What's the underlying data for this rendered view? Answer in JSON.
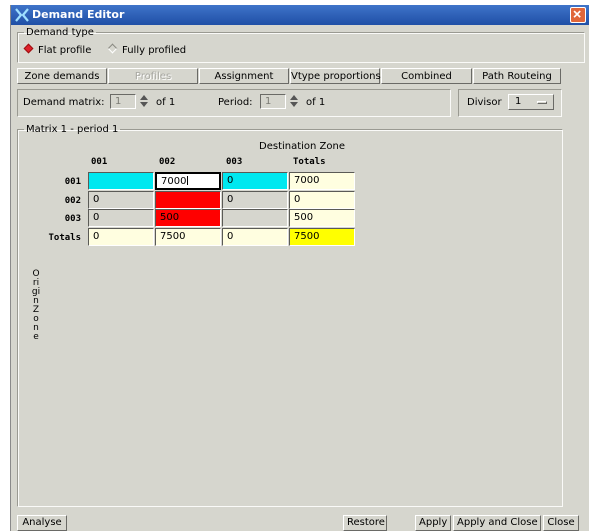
{
  "window": {
    "title": "Demand Editor"
  },
  "demand_type": {
    "legend": "Demand type",
    "options": [
      {
        "label": "Flat profile",
        "selected": true
      },
      {
        "label": "Fully profiled",
        "selected": false
      }
    ]
  },
  "tabs": [
    {
      "label": "Zone demands",
      "state": "active"
    },
    {
      "label": "Profiles",
      "state": "disabled"
    },
    {
      "label": "Assignment",
      "state": "normal"
    },
    {
      "label": "Vtype proportions",
      "state": "normal"
    },
    {
      "label": "Combined",
      "state": "normal"
    },
    {
      "label": "Path Routeing",
      "state": "normal"
    }
  ],
  "controls": {
    "demand_matrix_label": "Demand matrix:",
    "demand_matrix_value": "1",
    "demand_matrix_of": "of 1",
    "period_label": "Period:",
    "period_value": "1",
    "period_of": "of 1",
    "divisor_label": "Divisor",
    "divisor_value": "1"
  },
  "matrix": {
    "legend": "Matrix 1 - period 1",
    "destination_label": "Destination Zone",
    "origin_label": "Origin Zone",
    "columns": [
      "001",
      "002",
      "003",
      "Totals"
    ],
    "rows": [
      {
        "label": "001",
        "cells": [
          "",
          "7000",
          "0",
          "7000"
        ]
      },
      {
        "label": "002",
        "cells": [
          "0",
          "",
          "0",
          "0"
        ]
      },
      {
        "label": "003",
        "cells": [
          "0",
          "500",
          "",
          "500"
        ]
      },
      {
        "label": "Totals",
        "cells": [
          "0",
          "7500",
          "0",
          "7500"
        ]
      }
    ],
    "colors": {
      "cyan": "#00e8f0",
      "red": "#ff0000",
      "yellow": "#ffff00",
      "totals_bg": "#fffee0",
      "grey": "#d6d6ce",
      "edit_bg": "#ffffff"
    }
  },
  "buttons": {
    "analyse": "Analyse",
    "restore": "Restore",
    "apply": "Apply",
    "apply_close": "Apply and Close",
    "close": "Close"
  }
}
